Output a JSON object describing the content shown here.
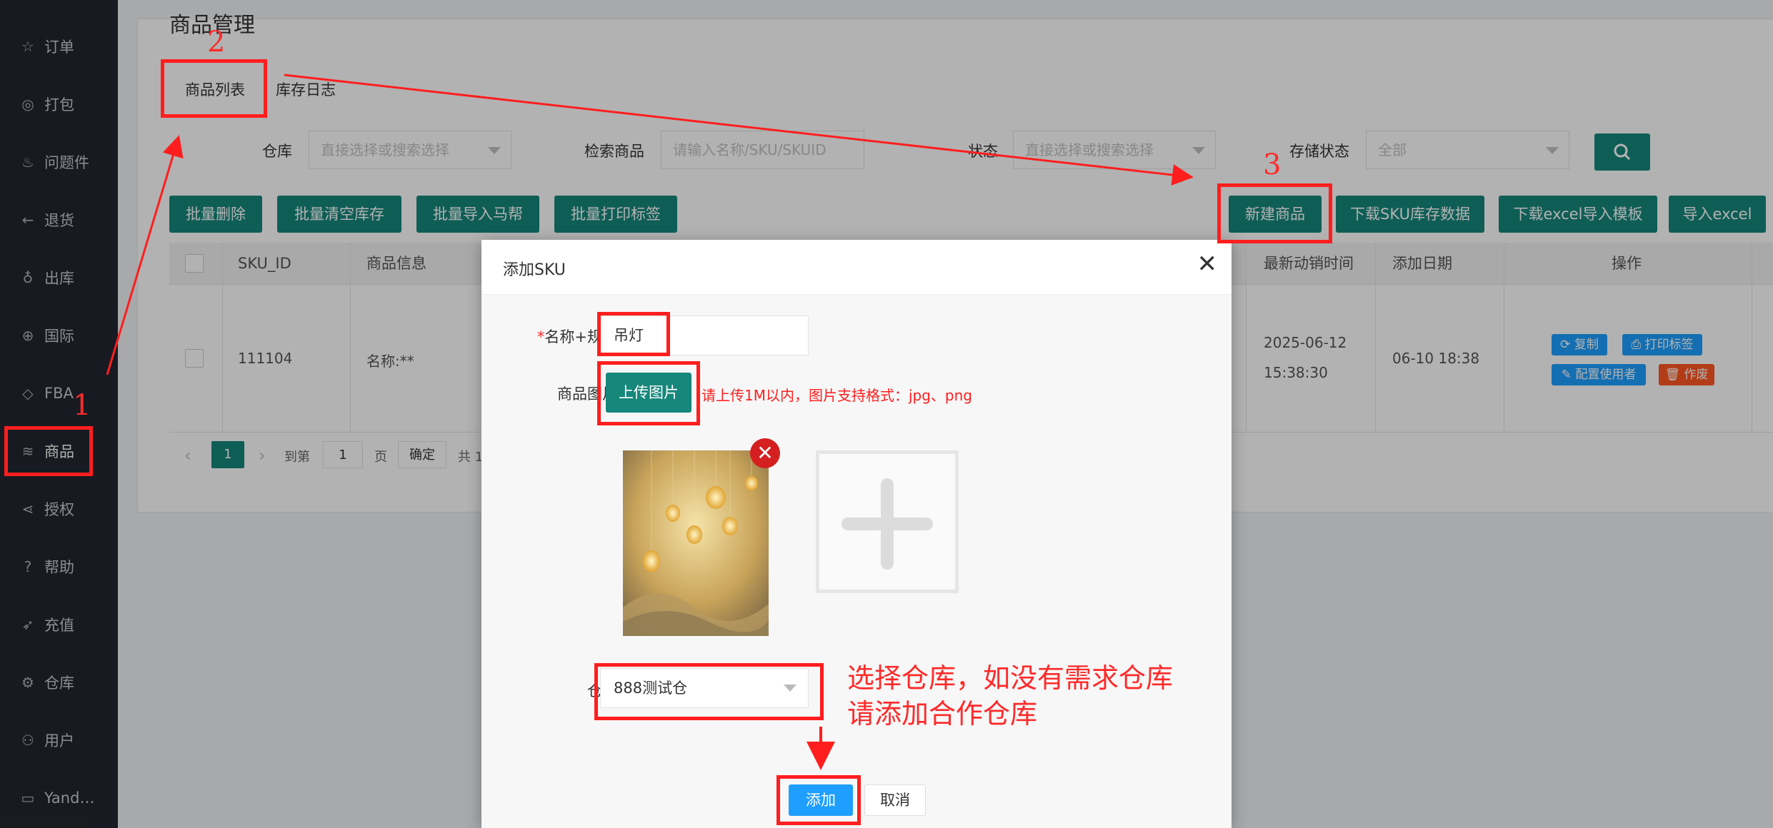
{
  "sidebar": {
    "items": [
      {
        "icon": "star-icon",
        "glyph": "☆",
        "label": "订单"
      },
      {
        "icon": "package-icon",
        "glyph": "◎",
        "label": "打包"
      },
      {
        "icon": "fire-icon",
        "glyph": "♨",
        "label": "问题件"
      },
      {
        "icon": "return-icon",
        "glyph": "←",
        "label": "退货"
      },
      {
        "icon": "flask-icon",
        "glyph": "♁",
        "label": "出库"
      },
      {
        "icon": "globe-icon",
        "glyph": "⊕",
        "label": "国际"
      },
      {
        "icon": "diamond-icon",
        "glyph": "◇",
        "label": "FBA"
      },
      {
        "icon": "layers-icon",
        "glyph": "≋",
        "label": "商品"
      },
      {
        "icon": "share-icon",
        "glyph": "⋖",
        "label": "授权"
      },
      {
        "icon": "help-icon",
        "glyph": "?",
        "label": "帮助"
      },
      {
        "icon": "send-icon",
        "glyph": "➶",
        "label": "充值"
      },
      {
        "icon": "gear-icon",
        "glyph": "⚙",
        "label": "仓库"
      },
      {
        "icon": "user-icon",
        "glyph": "⚇",
        "label": "用户"
      },
      {
        "icon": "window-icon",
        "glyph": "▭",
        "label": "Yand…"
      }
    ],
    "active_index": 7
  },
  "page": {
    "title": "商品管理",
    "tabs": [
      "商品列表",
      "库存日志"
    ]
  },
  "filters": {
    "warehouse_label": "仓库",
    "warehouse_placeholder": "直接选择或搜索选择",
    "search_label": "检索商品",
    "search_placeholder": "请输入名称/SKU/SKUID",
    "status_label": "状态",
    "status_placeholder": "直接选择或搜索选择",
    "storage_label": "存储状态",
    "storage_value": "全部"
  },
  "toolbar": {
    "batch_delete": "批量删除",
    "batch_clear": "批量清空库存",
    "batch_import": "批量导入马帮",
    "batch_print": "批量打印标签",
    "new_product": "新建商品",
    "download_sku": "下载SKU库存数据",
    "download_template": "下载excel导入模板",
    "import_excel": "导入excel"
  },
  "table": {
    "headers": {
      "sku_id": "SKU_ID",
      "info": "商品信息",
      "last_sale": "最新动销时间",
      "added": "添加日期",
      "ops": "操作"
    },
    "row": {
      "sku_id": "111104",
      "info": "名称:**",
      "last_sale_date": "2025-06-12",
      "last_sale_time": "15:38:30",
      "added": "06-10 18:38",
      "ops": {
        "copy": "复制",
        "print": "打印标签",
        "assign": "配置使用者",
        "void": "作废"
      }
    }
  },
  "pager": {
    "current": "1",
    "goto_label": "到第",
    "goto_value": "1",
    "page_unit": "页",
    "confirm": "确定",
    "total_prefix": "共 1"
  },
  "modal": {
    "title": "添加SKU",
    "name_label_req": "*",
    "name_label": "名称+规格",
    "name_value": "吊灯",
    "image_label": "商品图片",
    "upload_button": "上传图片",
    "upload_hint": "请上传1M以内，图片支持格式：jpg、png",
    "warehouse_label": "仓库",
    "warehouse_value": "888测试仓",
    "add_button": "添加",
    "cancel_button": "取消"
  },
  "annotations": {
    "n1": "1",
    "n2": "2",
    "n3": "3",
    "note_line1": "选择仓库，如没有需求仓库",
    "note_line2": "请添加合作仓库"
  },
  "colors": {
    "primary": "#16877b",
    "blue": "#1e9fff",
    "orange": "#ff5722",
    "annotation": "#ff1e1e",
    "sidebar": "#22262e"
  }
}
